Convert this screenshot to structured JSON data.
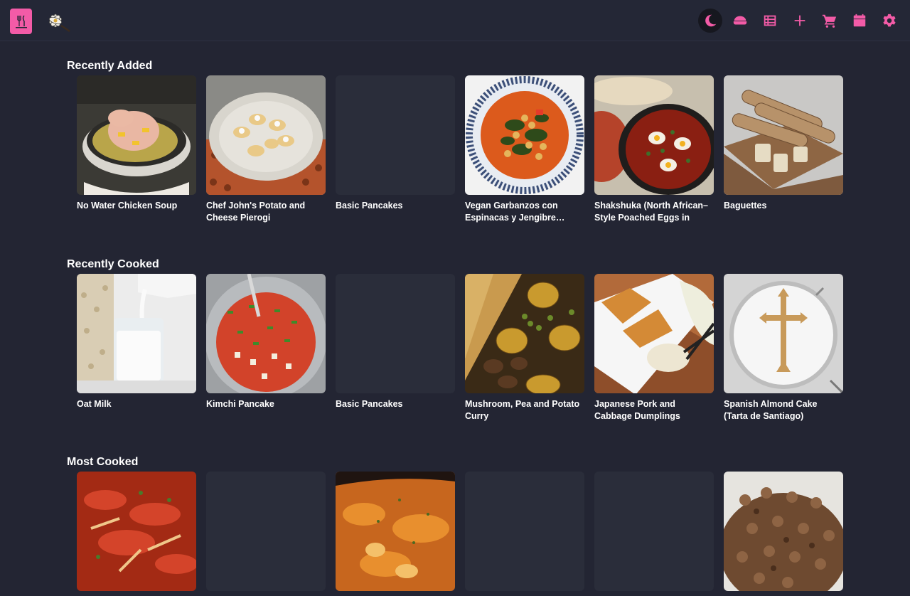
{
  "header": {
    "logo": "cookbook-icon",
    "mascot": "flower-icon",
    "nav": [
      {
        "name": "dark-mode-toggle",
        "icon": "moon-icon",
        "active": true
      },
      {
        "name": "meal-button",
        "icon": "bowl-icon",
        "active": false
      },
      {
        "name": "recipes-list-button",
        "icon": "table-icon",
        "active": false
      },
      {
        "name": "add-recipe-button",
        "icon": "plus-icon",
        "active": false
      },
      {
        "name": "shopping-cart-button",
        "icon": "cart-icon",
        "active": false
      },
      {
        "name": "calendar-button",
        "icon": "calendar-icon",
        "active": false
      },
      {
        "name": "settings-button",
        "icon": "gear-icon",
        "active": false
      }
    ]
  },
  "colors": {
    "accent": "#f35ba7",
    "background": "#232533",
    "card": "#2a2d3a"
  },
  "sections": [
    {
      "title": "Recently Added",
      "cards": [
        {
          "name": "No Water Chicken Soup",
          "image": "chicken"
        },
        {
          "name": "Chef John's Potato and Cheese Pierogi",
          "image": "pierogi"
        },
        {
          "name": "Basic Pancakes",
          "image": ""
        },
        {
          "name": "Vegan Garbanzos con Espinacas y Jengibre…",
          "image": "garbanzos"
        },
        {
          "name": "Shakshuka (North African–Style Poached Eggs in Spi…",
          "image": "shakshuka"
        },
        {
          "name": "Baguettes",
          "image": "baguette"
        }
      ]
    },
    {
      "title": "Recently Cooked",
      "cards": [
        {
          "name": "Oat Milk",
          "image": "oatmilk"
        },
        {
          "name": "Kimchi Pancake",
          "image": "kimchi"
        },
        {
          "name": "Basic Pancakes",
          "image": ""
        },
        {
          "name": "Mushroom, Pea and Potato Curry",
          "image": "curry"
        },
        {
          "name": "Japanese Pork and Cabbage Dumplings (Gyoza)",
          "image": "gyoza"
        },
        {
          "name": "Spanish Almond Cake (Tarta de Santiago)",
          "image": "tarta"
        }
      ]
    },
    {
      "title": "Most Cooked",
      "cards": [
        {
          "name": "",
          "image": "redstew"
        },
        {
          "name": "",
          "image": ""
        },
        {
          "name": "",
          "image": "soup"
        },
        {
          "name": "",
          "image": ""
        },
        {
          "name": "",
          "image": ""
        },
        {
          "name": "",
          "image": "mince"
        }
      ]
    }
  ]
}
